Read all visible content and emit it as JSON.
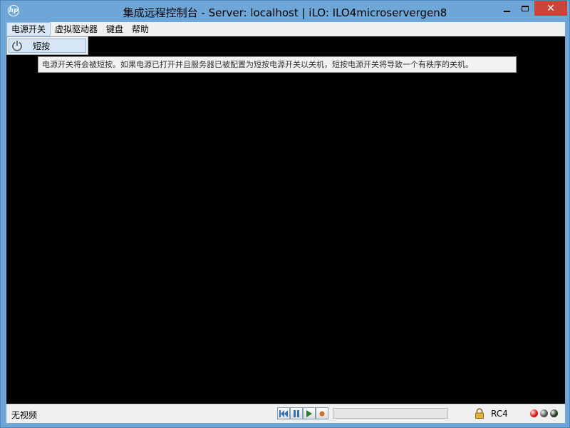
{
  "window": {
    "title": "集成远程控制台 - Server: localhost | iLO: ILO4microservergen8",
    "app_icon_text": "hp",
    "close_glyph": "✕"
  },
  "menubar": {
    "items": [
      {
        "label": "电源开关",
        "active": true
      },
      {
        "label": "虚拟驱动器",
        "active": false
      },
      {
        "label": "键盘",
        "active": false
      },
      {
        "label": "帮助",
        "active": false
      }
    ]
  },
  "power_menu": {
    "items": [
      {
        "label": "短按",
        "icon": "power-icon"
      }
    ]
  },
  "tooltip": {
    "text": "电源开关将会被短按。如果电源已打开并且服务器已被配置为短按电源开关以关机，短按电源开关将导致一个有秩序的关机。"
  },
  "statusbar": {
    "video_status": "无视频",
    "media_buttons": [
      "skip-back-icon",
      "pause-icon",
      "play-icon",
      "record-icon"
    ],
    "progress_fraction": 0,
    "encryption": "RC4",
    "leds": [
      {
        "name": "red-led",
        "color": "#e01010"
      },
      {
        "name": "gray-led",
        "color": "#555555"
      },
      {
        "name": "dark-led",
        "color": "#1e3a1e"
      }
    ]
  },
  "colors": {
    "accent": "#6fa6d8",
    "close_button": "#c9453a",
    "console_bg": "#000000"
  }
}
